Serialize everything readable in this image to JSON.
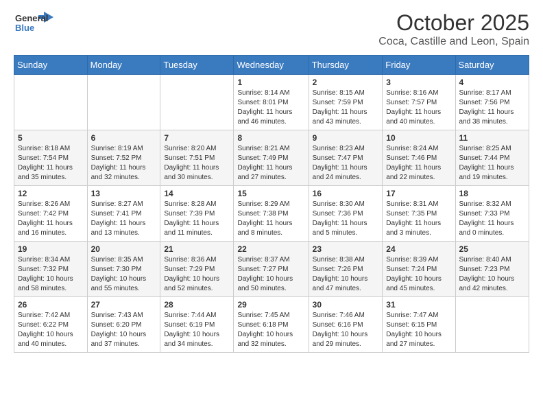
{
  "logo": {
    "general": "General",
    "blue": "Blue"
  },
  "header": {
    "month": "October 2025",
    "location": "Coca, Castille and Leon, Spain"
  },
  "weekdays": [
    "Sunday",
    "Monday",
    "Tuesday",
    "Wednesday",
    "Thursday",
    "Friday",
    "Saturday"
  ],
  "weeks": [
    [
      {
        "day": "",
        "info": ""
      },
      {
        "day": "",
        "info": ""
      },
      {
        "day": "",
        "info": ""
      },
      {
        "day": "1",
        "info": "Sunrise: 8:14 AM\nSunset: 8:01 PM\nDaylight: 11 hours\nand 46 minutes."
      },
      {
        "day": "2",
        "info": "Sunrise: 8:15 AM\nSunset: 7:59 PM\nDaylight: 11 hours\nand 43 minutes."
      },
      {
        "day": "3",
        "info": "Sunrise: 8:16 AM\nSunset: 7:57 PM\nDaylight: 11 hours\nand 40 minutes."
      },
      {
        "day": "4",
        "info": "Sunrise: 8:17 AM\nSunset: 7:56 PM\nDaylight: 11 hours\nand 38 minutes."
      }
    ],
    [
      {
        "day": "5",
        "info": "Sunrise: 8:18 AM\nSunset: 7:54 PM\nDaylight: 11 hours\nand 35 minutes."
      },
      {
        "day": "6",
        "info": "Sunrise: 8:19 AM\nSunset: 7:52 PM\nDaylight: 11 hours\nand 32 minutes."
      },
      {
        "day": "7",
        "info": "Sunrise: 8:20 AM\nSunset: 7:51 PM\nDaylight: 11 hours\nand 30 minutes."
      },
      {
        "day": "8",
        "info": "Sunrise: 8:21 AM\nSunset: 7:49 PM\nDaylight: 11 hours\nand 27 minutes."
      },
      {
        "day": "9",
        "info": "Sunrise: 8:23 AM\nSunset: 7:47 PM\nDaylight: 11 hours\nand 24 minutes."
      },
      {
        "day": "10",
        "info": "Sunrise: 8:24 AM\nSunset: 7:46 PM\nDaylight: 11 hours\nand 22 minutes."
      },
      {
        "day": "11",
        "info": "Sunrise: 8:25 AM\nSunset: 7:44 PM\nDaylight: 11 hours\nand 19 minutes."
      }
    ],
    [
      {
        "day": "12",
        "info": "Sunrise: 8:26 AM\nSunset: 7:42 PM\nDaylight: 11 hours\nand 16 minutes."
      },
      {
        "day": "13",
        "info": "Sunrise: 8:27 AM\nSunset: 7:41 PM\nDaylight: 11 hours\nand 13 minutes."
      },
      {
        "day": "14",
        "info": "Sunrise: 8:28 AM\nSunset: 7:39 PM\nDaylight: 11 hours\nand 11 minutes."
      },
      {
        "day": "15",
        "info": "Sunrise: 8:29 AM\nSunset: 7:38 PM\nDaylight: 11 hours\nand 8 minutes."
      },
      {
        "day": "16",
        "info": "Sunrise: 8:30 AM\nSunset: 7:36 PM\nDaylight: 11 hours\nand 5 minutes."
      },
      {
        "day": "17",
        "info": "Sunrise: 8:31 AM\nSunset: 7:35 PM\nDaylight: 11 hours\nand 3 minutes."
      },
      {
        "day": "18",
        "info": "Sunrise: 8:32 AM\nSunset: 7:33 PM\nDaylight: 11 hours\nand 0 minutes."
      }
    ],
    [
      {
        "day": "19",
        "info": "Sunrise: 8:34 AM\nSunset: 7:32 PM\nDaylight: 10 hours\nand 58 minutes."
      },
      {
        "day": "20",
        "info": "Sunrise: 8:35 AM\nSunset: 7:30 PM\nDaylight: 10 hours\nand 55 minutes."
      },
      {
        "day": "21",
        "info": "Sunrise: 8:36 AM\nSunset: 7:29 PM\nDaylight: 10 hours\nand 52 minutes."
      },
      {
        "day": "22",
        "info": "Sunrise: 8:37 AM\nSunset: 7:27 PM\nDaylight: 10 hours\nand 50 minutes."
      },
      {
        "day": "23",
        "info": "Sunrise: 8:38 AM\nSunset: 7:26 PM\nDaylight: 10 hours\nand 47 minutes."
      },
      {
        "day": "24",
        "info": "Sunrise: 8:39 AM\nSunset: 7:24 PM\nDaylight: 10 hours\nand 45 minutes."
      },
      {
        "day": "25",
        "info": "Sunrise: 8:40 AM\nSunset: 7:23 PM\nDaylight: 10 hours\nand 42 minutes."
      }
    ],
    [
      {
        "day": "26",
        "info": "Sunrise: 7:42 AM\nSunset: 6:22 PM\nDaylight: 10 hours\nand 40 minutes."
      },
      {
        "day": "27",
        "info": "Sunrise: 7:43 AM\nSunset: 6:20 PM\nDaylight: 10 hours\nand 37 minutes."
      },
      {
        "day": "28",
        "info": "Sunrise: 7:44 AM\nSunset: 6:19 PM\nDaylight: 10 hours\nand 34 minutes."
      },
      {
        "day": "29",
        "info": "Sunrise: 7:45 AM\nSunset: 6:18 PM\nDaylight: 10 hours\nand 32 minutes."
      },
      {
        "day": "30",
        "info": "Sunrise: 7:46 AM\nSunset: 6:16 PM\nDaylight: 10 hours\nand 29 minutes."
      },
      {
        "day": "31",
        "info": "Sunrise: 7:47 AM\nSunset: 6:15 PM\nDaylight: 10 hours\nand 27 minutes."
      },
      {
        "day": "",
        "info": ""
      }
    ]
  ]
}
